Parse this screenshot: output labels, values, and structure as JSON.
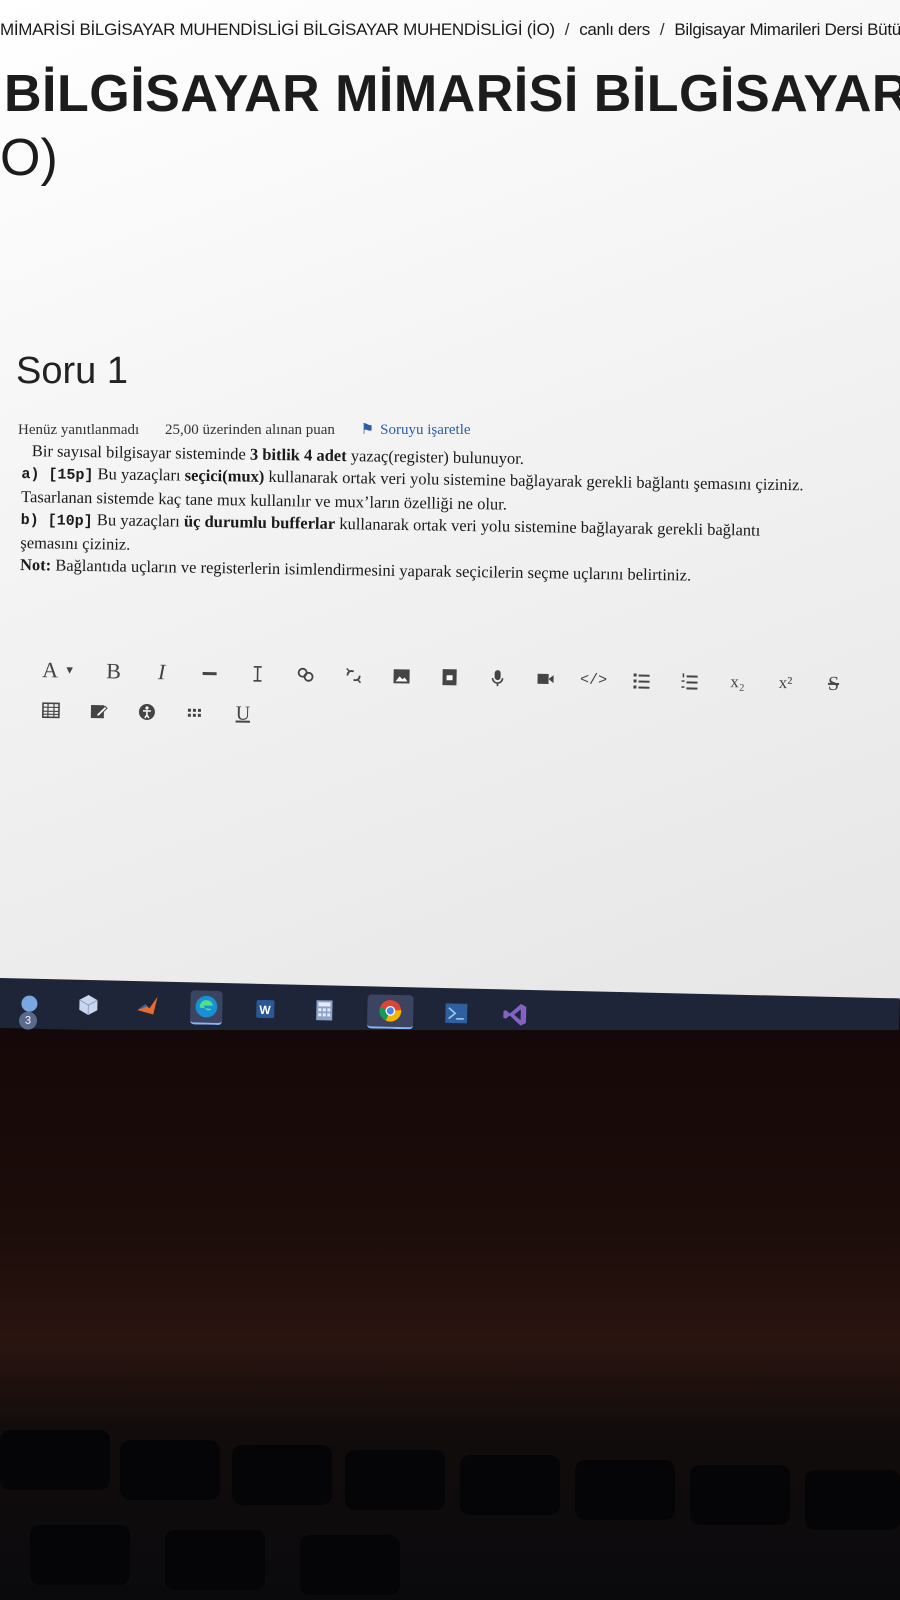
{
  "breadcrumb": {
    "items": [
      "MİMARİSİ BİLGİSAYAR MUHENDİSLİGİ BİLGİSAYAR MUHENDİSLİGİ (İO)",
      "canlı ders",
      "Bilgisayar Mimarileri Dersi Bütünlem"
    ],
    "separator": "/"
  },
  "course": {
    "title_line1": "BİLGİSAYAR MİMARİSİ BİLGİSAYAR M",
    "title_line2": "O)"
  },
  "question": {
    "title": "Soru 1",
    "status": "Henüz yanıtlanmadı",
    "points": "25,00 üzerinden alınan puan",
    "flag_label": "Soruyu işaretle",
    "intro_pre": "Bir sayısal bilgisayar sisteminde ",
    "intro_bold": "3 bitlik 4 adet",
    "intro_post": " yazaç(register) bulunuyor.",
    "a_label": "a) [15p]",
    "a_pre": " Bu yazaçları ",
    "a_bold": "seçici(mux)",
    "a_post": " kullanarak ortak veri yolu sistemine bağlayarak gerekli bağlantı şemasını çiziniz. Tasarlanan sistemde kaç tane mux kullanılır ve mux’ların özelliği ne olur.",
    "b_label": "b) [10p]",
    "b_pre": " Bu yazaçları ",
    "b_bold": "üç durumlu bufferlar",
    "b_post": " kullanarak ortak veri yolu sistemine bağlayarak gerekli bağlantı şemasını çiziniz.",
    "note_label": "Not:",
    "note_text": " Bağlantıda uçların ve registerlerin isimlendirmesini yaparak seçicilerin seçme uçlarını belirtiniz."
  },
  "editor": {
    "font_button": "A",
    "bold": "B",
    "italic": "I",
    "subscript": "x₂",
    "superscript": "x²",
    "strike": "S",
    "underline": "U",
    "icons": [
      "font-icon",
      "bold-icon",
      "italic-icon",
      "horizontal-rule-icon",
      "clear-format-icon",
      "link-icon",
      "unlink-icon",
      "image-icon",
      "media-icon",
      "microphone-icon",
      "video-icon",
      "code-icon",
      "bullet-list-icon",
      "numbered-list-icon",
      "subscript-icon",
      "superscript-icon",
      "strikethrough-icon",
      "table-icon",
      "edit-icon",
      "accessibility-icon",
      "grid-icon",
      "underline-icon"
    ]
  },
  "taskbar": {
    "badge_count": "3",
    "apps": [
      "weather-icon",
      "3d-cube-icon",
      "matlab-icon",
      "edge-icon",
      "word-icon",
      "calculator-icon",
      "chrome-icon",
      "remote-desktop-icon",
      "visual-studio-icon"
    ]
  },
  "colors": {
    "accent": "#2b5fa8",
    "taskbar": "#1e2538",
    "text": "#1a1a1a"
  }
}
